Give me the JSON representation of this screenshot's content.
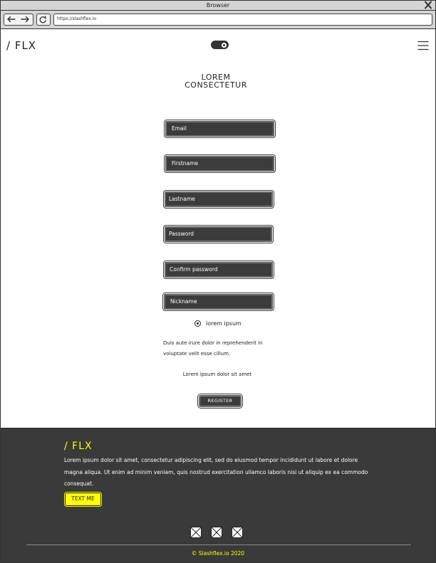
{
  "browser": {
    "title": "Browser",
    "url": "https://slashflex.io"
  },
  "header": {
    "logo": "/ FLX"
  },
  "form": {
    "title_line1": "LOREM",
    "title_line2": "CONSECTETUR",
    "fields": {
      "email": "Email",
      "firstname": "Firstname",
      "lastname": "Lastname",
      "password": "Password",
      "confirm_password": "Confirm password",
      "nickname": "Nickname"
    },
    "radio_label": "lorem ipsum",
    "paragraph": "Duis aute irure dolor in reprehenderit in voluptate velit esse cillum.",
    "small_text": "Lorem ipsum dolor sit amet",
    "register_label": "REGISTER"
  },
  "footer": {
    "logo": "/ FLX",
    "text": "Lorem ipsum dolor sit amet, consectetur adipiscing elit, sed do eiusmod tempor incididunt ut labore et dolore magna aliqua. Ut enim ad minim veniam, quis nostrud exercitation ullamco laboris nisi ut aliquip ex ea commodo consequat.",
    "button_label": "TEXT ME",
    "copyright": "© Slashflex.io 2020",
    "social_icons": [
      "image-placeholder-icon",
      "image-placeholder-icon",
      "image-placeholder-icon"
    ]
  },
  "colors": {
    "accent": "#ffff00",
    "dark": "#3a3a3a",
    "field": "#3c3c3c"
  }
}
